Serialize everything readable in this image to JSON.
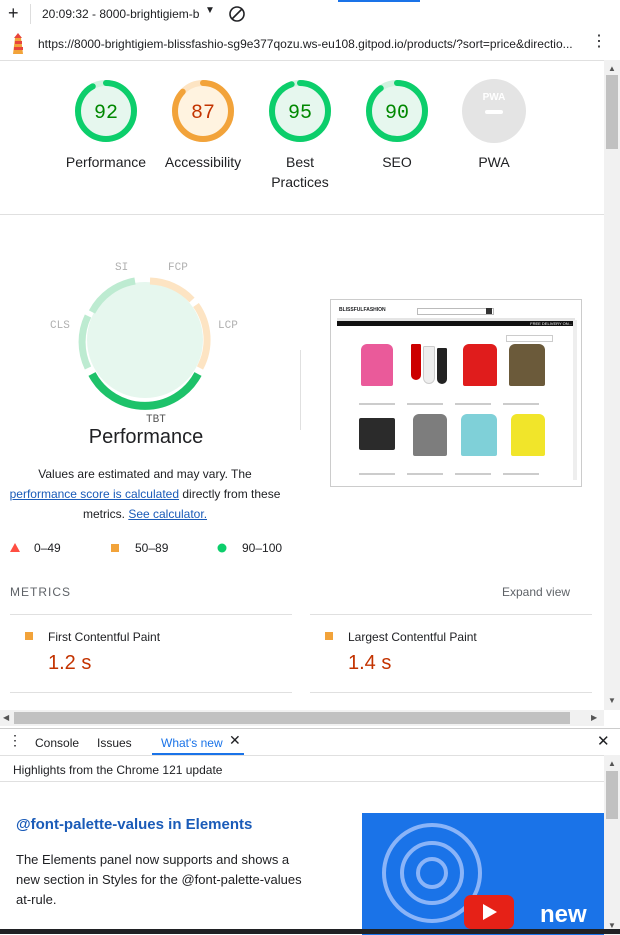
{
  "topbar": {
    "time_title": "20:09:32 - 8000-brightigiem-b"
  },
  "urlbar": {
    "url": "https://8000-brightigiem-blissfashio-sg9e377qozu.ws-eu108.gitpod.io/products/?sort=price&directio..."
  },
  "scores": [
    {
      "value": "92",
      "label": "Performance",
      "color": "#0cce6b",
      "text_color": "#008800",
      "fill": 0.92
    },
    {
      "value": "87",
      "label": "Accessibility",
      "color": "#f2a33a",
      "text_color": "#c33300",
      "fill": 0.87
    },
    {
      "value": "95",
      "label": "Best Practices",
      "color": "#0cce6b",
      "text_color": "#008800",
      "fill": 0.95
    },
    {
      "value": "90",
      "label": "SEO",
      "color": "#0cce6b",
      "text_color": "#008800",
      "fill": 0.9
    },
    {
      "value": "",
      "label": "PWA",
      "icon": "pwa-icon"
    }
  ],
  "perf": {
    "title": "Performance",
    "segments": {
      "si": "SI",
      "fcp": "FCP",
      "lcp": "LCP",
      "tbt": "TBT",
      "cls": "CLS"
    },
    "desc_1": "Values are estimated and may vary. The",
    "desc_link_1": "performance score is calculated",
    "desc_2": "directly from these",
    "desc_3": "metrics.",
    "desc_link_2": "See calculator."
  },
  "legend": [
    {
      "range": "0–49",
      "shape": "triangle",
      "color": "#ff4e42"
    },
    {
      "range": "50–89",
      "shape": "square",
      "color": "#f2a33a"
    },
    {
      "range": "90–100",
      "shape": "circle",
      "color": "#0cce6b"
    }
  ],
  "metrics": {
    "heading": "METRICS",
    "expand": "Expand view",
    "items": [
      {
        "title": "First Contentful Paint",
        "value": "1.2 s"
      },
      {
        "title": "Largest Contentful Paint",
        "value": "1.4 s"
      }
    ]
  },
  "devtools": {
    "tabs": [
      "Console",
      "Issues",
      "What's new"
    ],
    "highlights": "Highlights from the Chrome 121 update",
    "article_title": "@font-palette-values in Elements",
    "article_body": "The Elements panel now supports and shows a new section in Styles for the @font-palette-values at-rule.",
    "video_text": "new"
  },
  "screenshot": {
    "brand": "BLISSFULFASHION",
    "banner": "FREE DELIVERY ON..."
  }
}
